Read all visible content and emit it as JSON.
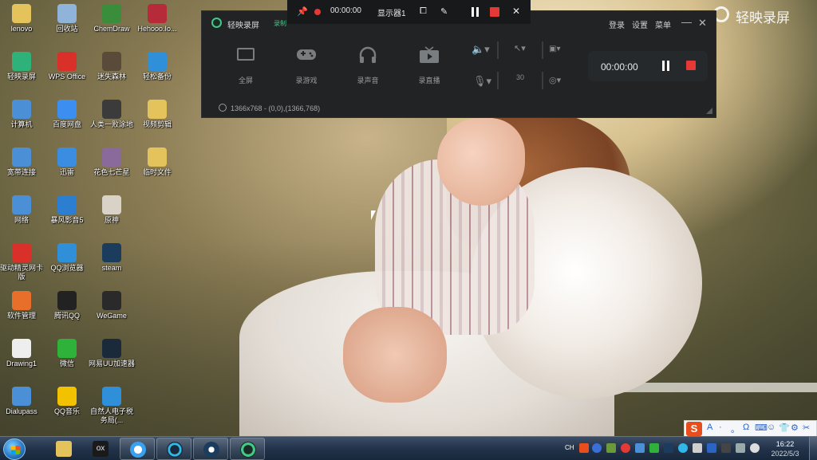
{
  "desktop": {
    "icons": [
      {
        "label": "lenovo",
        "icon": "folder-icon",
        "color": "#e4c25c"
      },
      {
        "label": "回收站",
        "icon": "recycle-bin-icon",
        "color": "#8fb3d9"
      },
      {
        "label": "ChemDraw",
        "icon": "chemdraw-icon",
        "color": "#3a8d3a"
      },
      {
        "label": "Hehooo.Io...",
        "icon": "hehooo-icon",
        "color": "#b72a3a"
      },
      {
        "label": "轻映录屏",
        "icon": "recorder-app-icon",
        "color": "#2fb27a"
      },
      {
        "label": "WPS Office",
        "icon": "wps-icon",
        "color": "#d9302a"
      },
      {
        "label": "迷失森林",
        "icon": "game-icon",
        "color": "#5a4a3a"
      },
      {
        "label": "轻松备份",
        "icon": "backup-icon",
        "color": "#2f8fd9"
      },
      {
        "label": "计算机",
        "icon": "computer-icon",
        "color": "#4b8fd6"
      },
      {
        "label": "百度网盘",
        "icon": "baidu-netdisk-icon",
        "color": "#3c8ef0"
      },
      {
        "label": "人类一败涂地",
        "icon": "game-icon",
        "color": "#3b3b3b"
      },
      {
        "label": "视频剪辑",
        "icon": "folder-icon",
        "color": "#e4c25c"
      },
      {
        "label": "宽带连接",
        "icon": "network-icon",
        "color": "#4b8fd6"
      },
      {
        "label": "迅雷",
        "icon": "thunder-icon",
        "color": "#3a8de0"
      },
      {
        "label": "花色七芒星",
        "icon": "game-icon",
        "color": "#8a6a9a"
      },
      {
        "label": "临时文件",
        "icon": "folder-icon",
        "color": "#e4c25c"
      },
      {
        "label": "网络",
        "icon": "network-icon",
        "color": "#4b8fd6"
      },
      {
        "label": "暴风影音5",
        "icon": "media-player-icon",
        "color": "#2c7fd0"
      },
      {
        "label": "原神",
        "icon": "genshin-icon",
        "color": "#d9d2c6"
      },
      {
        "label": "驱动精灵网卡版",
        "icon": "driver-icon",
        "color": "#d9302a"
      },
      {
        "label": "QQ浏览器",
        "icon": "qq-browser-icon",
        "color": "#2f8fd9"
      },
      {
        "label": "steam",
        "icon": "steam-icon",
        "color": "#1b3c5c"
      },
      {
        "label": "软件管理",
        "icon": "software-manager-icon",
        "color": "#e86f2a"
      },
      {
        "label": "腾讯QQ",
        "icon": "qq-icon",
        "color": "#222222"
      },
      {
        "label": "WeGame",
        "icon": "wegame-icon",
        "color": "#2a2a2a"
      },
      {
        "label": "Drawing1",
        "icon": "drawing-icon",
        "color": "#eeeeee"
      },
      {
        "label": "微信",
        "icon": "wechat-icon",
        "color": "#2fb23a"
      },
      {
        "label": "网易UU加速器",
        "icon": "uu-accelerator-icon",
        "color": "#1a2a3a"
      },
      {
        "label": "Dialupass",
        "icon": "dialupass-icon",
        "color": "#4b8fd6"
      },
      {
        "label": "QQ音乐",
        "icon": "qq-music-icon",
        "color": "#f2c200"
      },
      {
        "label": "自然人电子税务局(...",
        "icon": "tax-app-icon",
        "color": "#2f8fd9"
      }
    ]
  },
  "float_bar": {
    "timer": "00:00:00",
    "display": "显示器1"
  },
  "recorder": {
    "title": "轻映录屏",
    "title_extra": "录制",
    "menu": {
      "login": "登录",
      "settings": "设置",
      "more": "菜单"
    },
    "modes": [
      "全屏",
      "录游戏",
      "录声音",
      "录直播"
    ],
    "fps": "30",
    "resolution": "1366x768 - (0,0),(1366,768)",
    "timer": "00:00:00"
  },
  "watermark": {
    "text": "轻映录屏"
  },
  "ime": {
    "items": [
      "A",
      "·",
      "。",
      "Ω",
      "⌨",
      "☺",
      "👕",
      "⚙",
      "✂"
    ]
  },
  "taskbar": {
    "apps": [
      "file-explorer",
      "mediaplayer",
      "qq-browser",
      "uu-accelerator",
      "steam",
      "recorder"
    ],
    "clock": {
      "time": "16:22",
      "date": "2022/5/3"
    },
    "tray_text": "CH"
  }
}
